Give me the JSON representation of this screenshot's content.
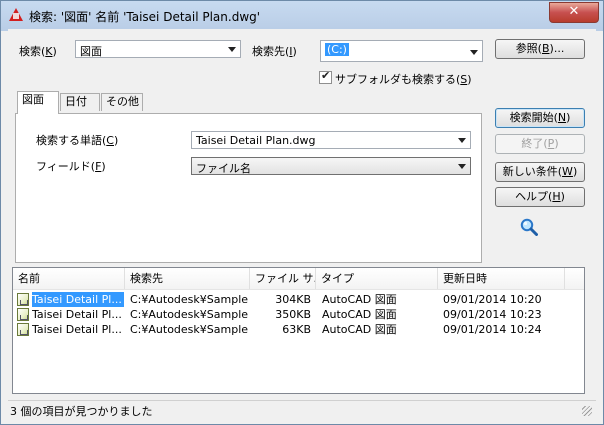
{
  "window": {
    "title": "検索: '図面' 名前 'Taisei Detail Plan.dwg'",
    "close_label": "✕"
  },
  "search": {
    "type_label": "検索(",
    "type_key": "K",
    "type_suffix": ")",
    "type_value": "図面",
    "location_label": "検索先(",
    "location_key": "I",
    "location_suffix": ")",
    "location_value": "(C:)",
    "browse_label": "参照(",
    "browse_key": "B",
    "browse_suffix": ")...",
    "subfolders_label": "サブフォルダも検索する(",
    "subfolders_key": "S",
    "subfolders_suffix": ")",
    "subfolders_checked": true
  },
  "tabs": [
    {
      "label": "図面"
    },
    {
      "label": "日付"
    },
    {
      "label": "その他"
    }
  ],
  "drawing_tab": {
    "words_label": "検索する単語(",
    "words_key": "C",
    "words_suffix": ")",
    "words_value": "Taisei Detail Plan.dwg",
    "field_label": "フィールド(",
    "field_key": "F",
    "field_suffix": ")",
    "field_value": "ファイル名"
  },
  "actions": {
    "start_label": "検索開始(",
    "start_key": "N",
    "start_suffix": ")",
    "stop_label": "終了(",
    "stop_key": "P",
    "stop_suffix": ")",
    "new_label": "新しい条件(",
    "new_key": "W",
    "new_suffix": ")",
    "help_label": "ヘルプ(",
    "help_key": "H",
    "help_suffix": ")"
  },
  "results": {
    "columns": [
      "名前",
      "検索先",
      "ファイル サ...",
      "タイプ",
      "更新日時"
    ],
    "rows": [
      {
        "name": "Taisei Detail Pl...",
        "location": "C:¥Autodesk¥Sample...",
        "size": "304KB",
        "type": "AutoCAD 図面",
        "modified": "09/01/2014  10:20"
      },
      {
        "name": "Taisei Detail Pl...",
        "location": "C:¥Autodesk¥Sample...",
        "size": "350KB",
        "type": "AutoCAD 図面",
        "modified": "09/01/2014  10:23"
      },
      {
        "name": "Taisei Detail Pl...",
        "location": "C:¥Autodesk¥Sample...",
        "size": "63KB",
        "type": "AutoCAD 図面",
        "modified": "09/01/2014  10:24"
      }
    ]
  },
  "status": {
    "text": "3 個の項目が見つかりました"
  }
}
